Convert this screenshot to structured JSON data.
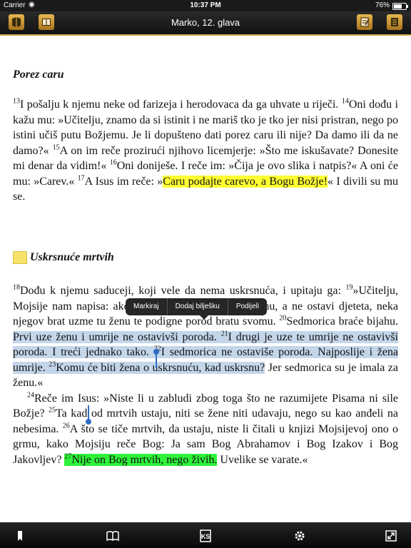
{
  "status": {
    "carrier": "Carrier",
    "time": "10:37 PM",
    "battery": "76%",
    "battery_level": 0.76
  },
  "nav": {
    "title": "Marko, 12. glava"
  },
  "section1": {
    "heading": "Porez caru",
    "v13": "13",
    "t13": "I pošalju k njemu neke od farizeja i herodovaca da ga uhvate u riječi.",
    "v14": "14",
    "t14": "Oni dođu i kažu mu: »Učitelju, znamo da si istinit i ne mariš tko je tko jer nisi pristran, nego po istini učiš putu Božjemu. Je li dopušteno dati porez caru ili nije? Da damo ili da ne damo?« ",
    "v15": "15",
    "t15": "A on im reče prozirući njihovo licemjerje: »Što me iskušavate? Donesite mi denar da vidim!« ",
    "v16": "16",
    "t16": "Oni doniješe. I reče im: »Čija je ovo slika i natpis?« A oni će mu: »Carev.« ",
    "v17": "17",
    "t17a": "A Isus im reče: »",
    "t17hl": "Caru podajte carevo, a Bogu Božje!",
    "t17b": "« I divili su mu se."
  },
  "section2": {
    "heading": "Uskrsnuće mrtvih",
    "v18": "18",
    "t18": "Dođu k njemu saduceji, koji vele da nema uskrsnuća, i upitaju ga: ",
    "v19": "19",
    "t19": "»Učitelju, Mojsije nam napisa: ako umre nečiji brat i ostavi ženu, a ne ostavi djeteta, neka njegov brat uzme tu ženu te podigne porod bratu svomu. ",
    "v20": "20",
    "t20a": "Sedmorica braće bijahu. ",
    "t20sel": "Prvi uze ženu i umrije ne ostavivši poroda. ",
    "v21": "21",
    "t21": "I drugi je uze te umrije ne ostavivši poroda. I treći jednako tako. ",
    "v22": "22",
    "t22": "I sedmorica ne ostaviše poroda. Najposlije i žena umrije. ",
    "v23": "23",
    "t23sel": "Komu će biti žena o uskrsnuću, kad uskrsnu?",
    "t23b": " Jer sedmorica su je imala za ženu.«",
    "v24": "24",
    "t24": "Reče im Isus: »Niste li u zabludi zbog toga što ne razumijete Pisama ni sile Božje? ",
    "v25": "25",
    "t25": "Ta kad od mrtvih ustaju, niti se žene niti udavaju, nego su kao anđeli na nebesima. ",
    "v26": "26",
    "t26": "A što se tiče mrtvih, da ustaju, niste li čitali u knjizi Mojsijevoj ono o grmu, kako Mojsiju reče Bog: Ja sam Bog Abrahamov i Bog Izakov i Bog Jakovljev? ",
    "v27": "27",
    "t27hl": "Nije on Bog mrtvih, nego živih.",
    "t27b": " Uvelike se varate.«"
  },
  "popup": {
    "mark": "Markiraj",
    "add_note": "Dodaj bilješku",
    "share": "Podijeli"
  },
  "colors": {
    "accent": "#c9a24a",
    "highlight_yellow": "#ffff33",
    "highlight_green": "#2ef23a",
    "selection": "#c4d6ea"
  },
  "toolbar_icons": [
    "bookmark-icon",
    "book-open-icon",
    "ks-logo-icon",
    "gear-icon",
    "fullscreen-icon"
  ]
}
